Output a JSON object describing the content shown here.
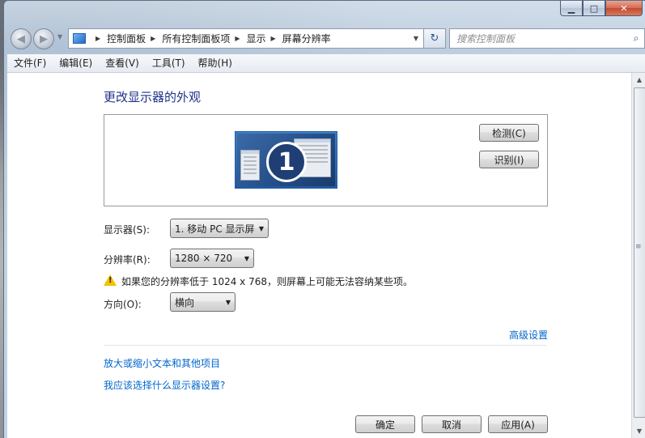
{
  "window": {
    "caption": {
      "minimize": "▁",
      "maximize": "□",
      "close": "✕"
    }
  },
  "nav": {
    "back_glyph": "◀",
    "forward_glyph": "▶",
    "breadcrumbs": [
      "控制面板",
      "所有控制面板项",
      "显示",
      "屏幕分辨率"
    ],
    "search_placeholder": "搜索控制面板",
    "refresh_glyph": "↻",
    "search_glyph": "⌕"
  },
  "menu": {
    "items": [
      "文件(F)",
      "编辑(E)",
      "查看(V)",
      "工具(T)",
      "帮助(H)"
    ]
  },
  "main": {
    "title": "更改显示器的外观",
    "monitor_number": "1",
    "detect_button": "检测(C)",
    "identify_button": "识别(I)",
    "display_label": "显示器(S):",
    "display_value": "1. 移动 PC 显示屏",
    "resolution_label": "分辨率(R):",
    "resolution_value": "1280 × 720",
    "warning_text": "如果您的分辨率低于 1024 x 768，则屏幕上可能无法容纳某些项。",
    "orientation_label": "方向(O):",
    "orientation_value": "横向",
    "advanced_link": "高级设置",
    "link_text_size": "放大或缩小文本和其他项目",
    "link_which_settings": "我应该选择什么显示器设置?",
    "ok_button": "确定",
    "cancel_button": "取消",
    "apply_button": "应用(A)"
  },
  "colors": {
    "link": "#0066cc",
    "title": "#1e3287",
    "warning": "#f2c200"
  }
}
